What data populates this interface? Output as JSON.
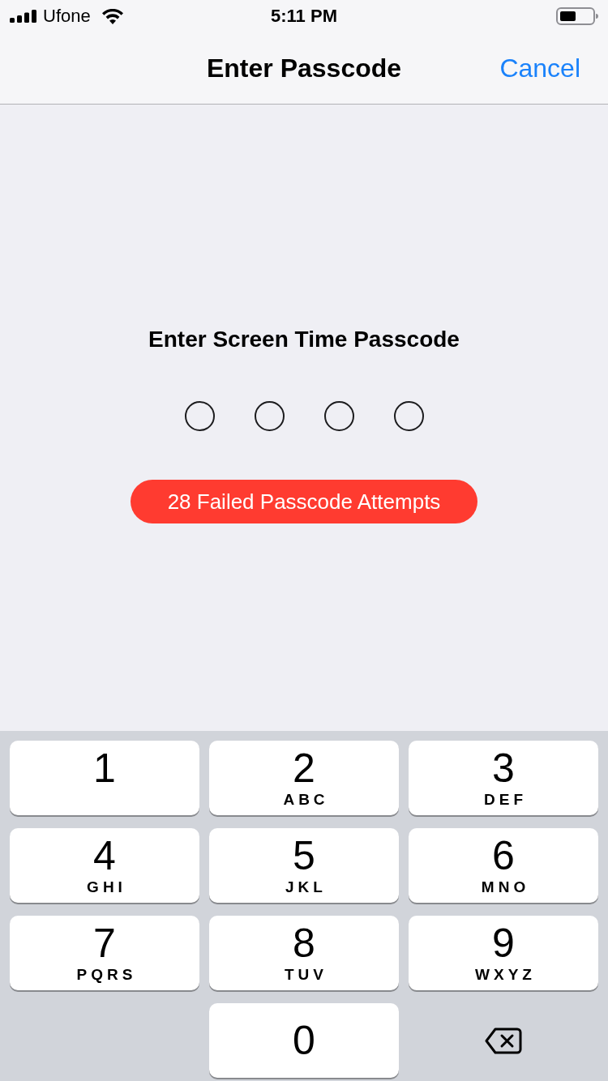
{
  "status_bar": {
    "carrier": "Ufone",
    "time": "5:11 PM"
  },
  "nav_bar": {
    "title": "Enter Passcode",
    "cancel": "Cancel"
  },
  "passcode": {
    "prompt": "Enter Screen Time Passcode",
    "dots": [
      {
        "filled": false
      },
      {
        "filled": false
      },
      {
        "filled": false
      },
      {
        "filled": false
      }
    ],
    "failed_attempts": "28 Failed Passcode Attempts"
  },
  "keypad": {
    "rows": [
      [
        {
          "kind": "digit",
          "digit": "1"
        },
        {
          "kind": "digit",
          "digit": "2",
          "letters": "ABC"
        },
        {
          "kind": "digit",
          "digit": "3",
          "letters": "DEF"
        }
      ],
      [
        {
          "kind": "digit",
          "digit": "4",
          "letters": "GHI"
        },
        {
          "kind": "digit",
          "digit": "5",
          "letters": "JKL"
        },
        {
          "kind": "digit",
          "digit": "6",
          "letters": "MNO"
        }
      ],
      [
        {
          "kind": "digit",
          "digit": "7",
          "letters": "PQRS"
        },
        {
          "kind": "digit",
          "digit": "8",
          "letters": "TUV"
        },
        {
          "kind": "digit",
          "digit": "9",
          "letters": "WXYZ"
        }
      ],
      [
        {
          "kind": "spacer"
        },
        {
          "kind": "digit",
          "digit": "0"
        },
        {
          "kind": "delete"
        }
      ]
    ]
  }
}
